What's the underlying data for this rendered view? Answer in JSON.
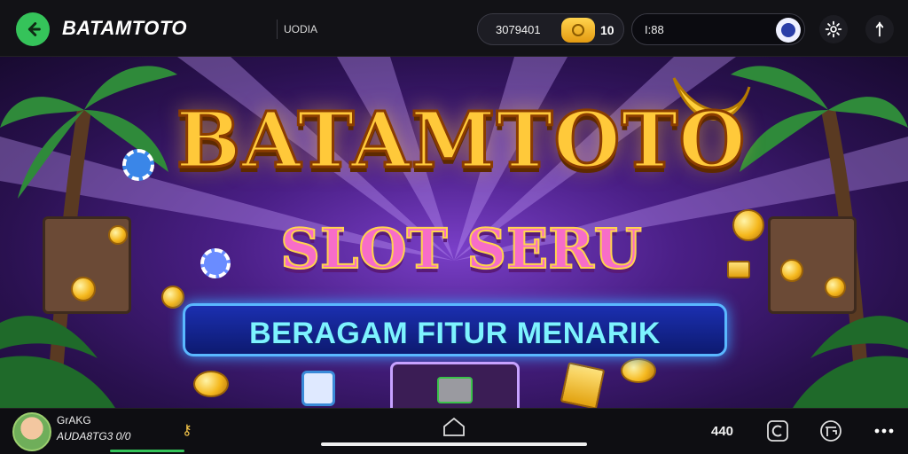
{
  "header": {
    "back_icon": "arrow-left-icon",
    "brand": "BATAMTOTO",
    "mini_label": "UODIA",
    "balance": "3079401",
    "coin_icon": "coin-icon",
    "balance_count": "10",
    "search_text": "I:88",
    "search_icon": "globe-icon",
    "settings_icon": "gear-icon",
    "extra_icon": "pin-icon",
    "accent_color": "#35c35a"
  },
  "banner": {
    "title": "BATAMTOTO",
    "subtitle": "SLOT SERU",
    "tagline": "BERAGAM FITUR MENARIK",
    "title_color": "#ffc93a",
    "subtitle_color": "#f76dc8",
    "tagline_color": "#7df3ff"
  },
  "footer": {
    "user_name": "GrAKG",
    "user_sub": "AUDA8TG3 0/0",
    "user_progress": 1.0,
    "badge_icon": "key-icon",
    "home_icon": "home-outline-icon",
    "count": "440",
    "copyright_icon": "copyright-icon",
    "grid_icon": "grid-frame-icon",
    "menu_icon": "more-dots-icon"
  }
}
